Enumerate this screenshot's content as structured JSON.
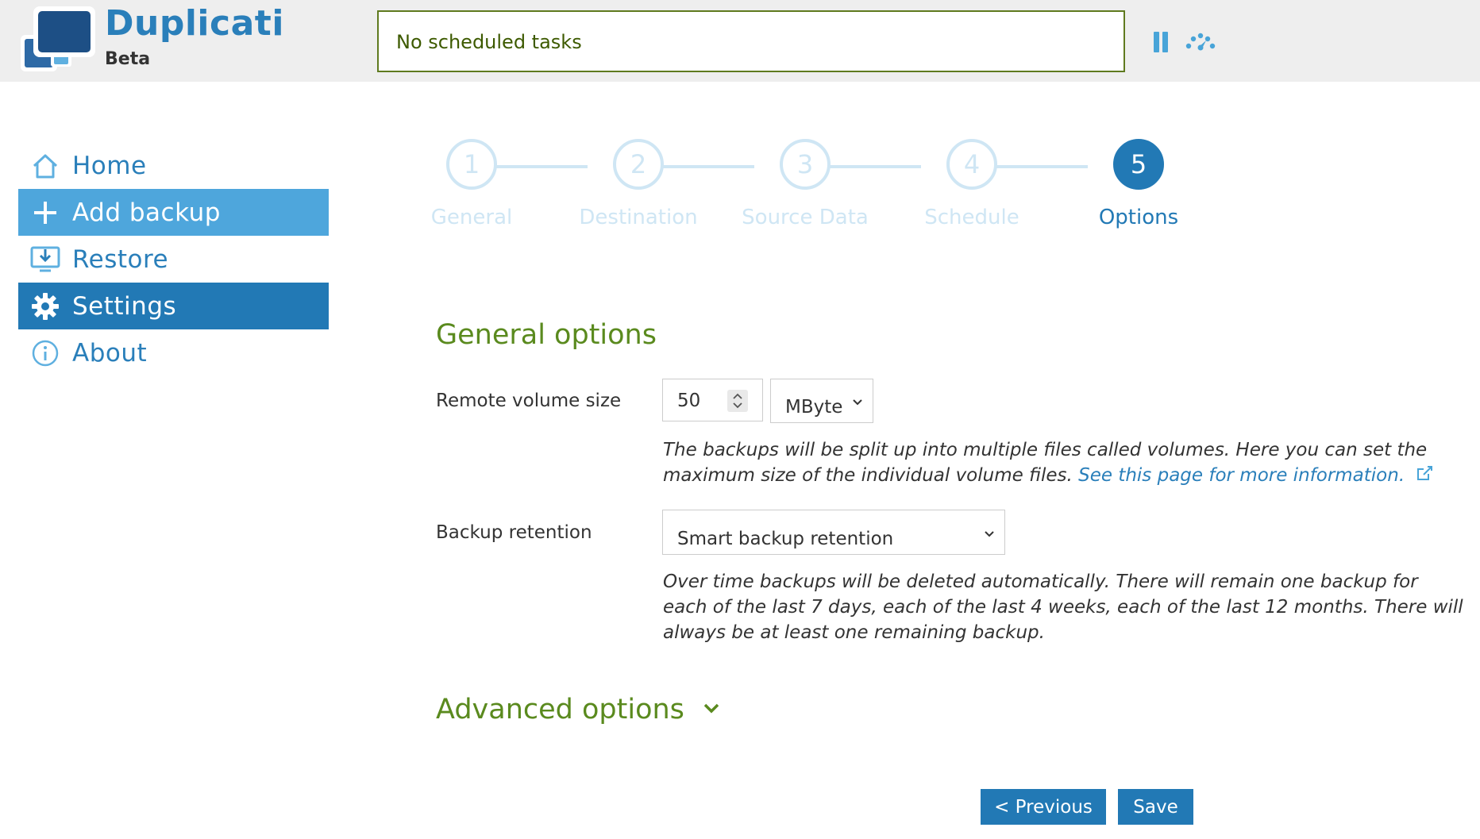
{
  "header": {
    "brand_name": "Duplicati",
    "brand_subtitle": "Beta",
    "status_text": "No scheduled tasks",
    "pause_icon": "pause-icon",
    "throttle_icon": "speed-gauge-icon"
  },
  "sidebar": {
    "items": [
      {
        "label": "Home",
        "icon": "home-icon"
      },
      {
        "label": "Add backup",
        "icon": "plus-icon"
      },
      {
        "label": "Restore",
        "icon": "restore-icon"
      },
      {
        "label": "Settings",
        "icon": "gear-icon"
      },
      {
        "label": "About",
        "icon": "info-icon"
      }
    ]
  },
  "wizard": {
    "current_step": 5,
    "steps": [
      {
        "number": "1",
        "label": "General"
      },
      {
        "number": "2",
        "label": "Destination"
      },
      {
        "number": "3",
        "label": "Source Data"
      },
      {
        "number": "4",
        "label": "Schedule"
      },
      {
        "number": "5",
        "label": "Options"
      }
    ]
  },
  "general_options": {
    "title": "General options",
    "remote_volume": {
      "label": "Remote volume size",
      "value": "50",
      "unit": "MByte",
      "help": "The backups will be split up into multiple files called volumes. Here you can set the maximum size of the individual volume files.",
      "link_text": "See this page for more information."
    },
    "retention": {
      "label": "Backup retention",
      "value": "Smart backup retention",
      "help": "Over time backups will be deleted automatically. There will remain one backup for each of the last 7 days, each of the last 4 weeks, each of the last 12 months. There will always be at least one remaining backup."
    }
  },
  "advanced_options": {
    "title": "Advanced options"
  },
  "buttons": {
    "previous": "< Previous",
    "save": "Save"
  },
  "colors": {
    "accent": "#2279b5",
    "accent_light": "#4ea6dc",
    "section_green": "#5a8a1e",
    "step_inactive": "#cfe6f4",
    "header_bg": "#eeeeee"
  }
}
